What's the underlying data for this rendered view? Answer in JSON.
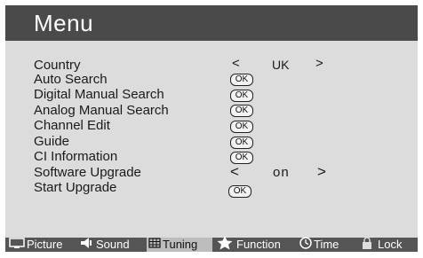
{
  "header": {
    "title": "Menu"
  },
  "menu": {
    "country": {
      "label": "Country",
      "left_arrow": "<",
      "value": "UK",
      "right_arrow": ">"
    },
    "auto_search": {
      "label": "Auto Search",
      "button": "OK"
    },
    "digital_manual_search": {
      "label": "Digital Manual Search",
      "button": "OK"
    },
    "analog_manual_search": {
      "label": "Analog Manual Search",
      "button": "OK"
    },
    "channel_edit": {
      "label": "Channel Edit",
      "button": "OK"
    },
    "guide": {
      "label": "Guide",
      "button": "OK"
    },
    "ci_information": {
      "label": "CI Information",
      "button": "OK"
    },
    "software_upgrade": {
      "label": "Software Upgrade",
      "left_arrow": "<",
      "value": "on",
      "right_arrow": ">"
    },
    "start_upgrade": {
      "label": "Start Upgrade",
      "button": "OK"
    }
  },
  "bottom_tabs": {
    "picture": {
      "label": "Picture",
      "icon": "screen-icon"
    },
    "sound": {
      "label": "Sound",
      "icon": "speaker-icon"
    },
    "tuning": {
      "label": "Tuning",
      "icon": "grid-icon",
      "active": true
    },
    "function": {
      "label": "Function",
      "icon": "star-icon"
    },
    "time": {
      "label": "Time",
      "icon": "clock-icon"
    },
    "lock": {
      "label": "Lock",
      "icon": "lock-icon"
    }
  },
  "colors": {
    "background": "#dcdcdc",
    "title_bar": "#4a4a4a",
    "bottom_bar": "#555555",
    "active_tab": "#bdbdbd"
  }
}
